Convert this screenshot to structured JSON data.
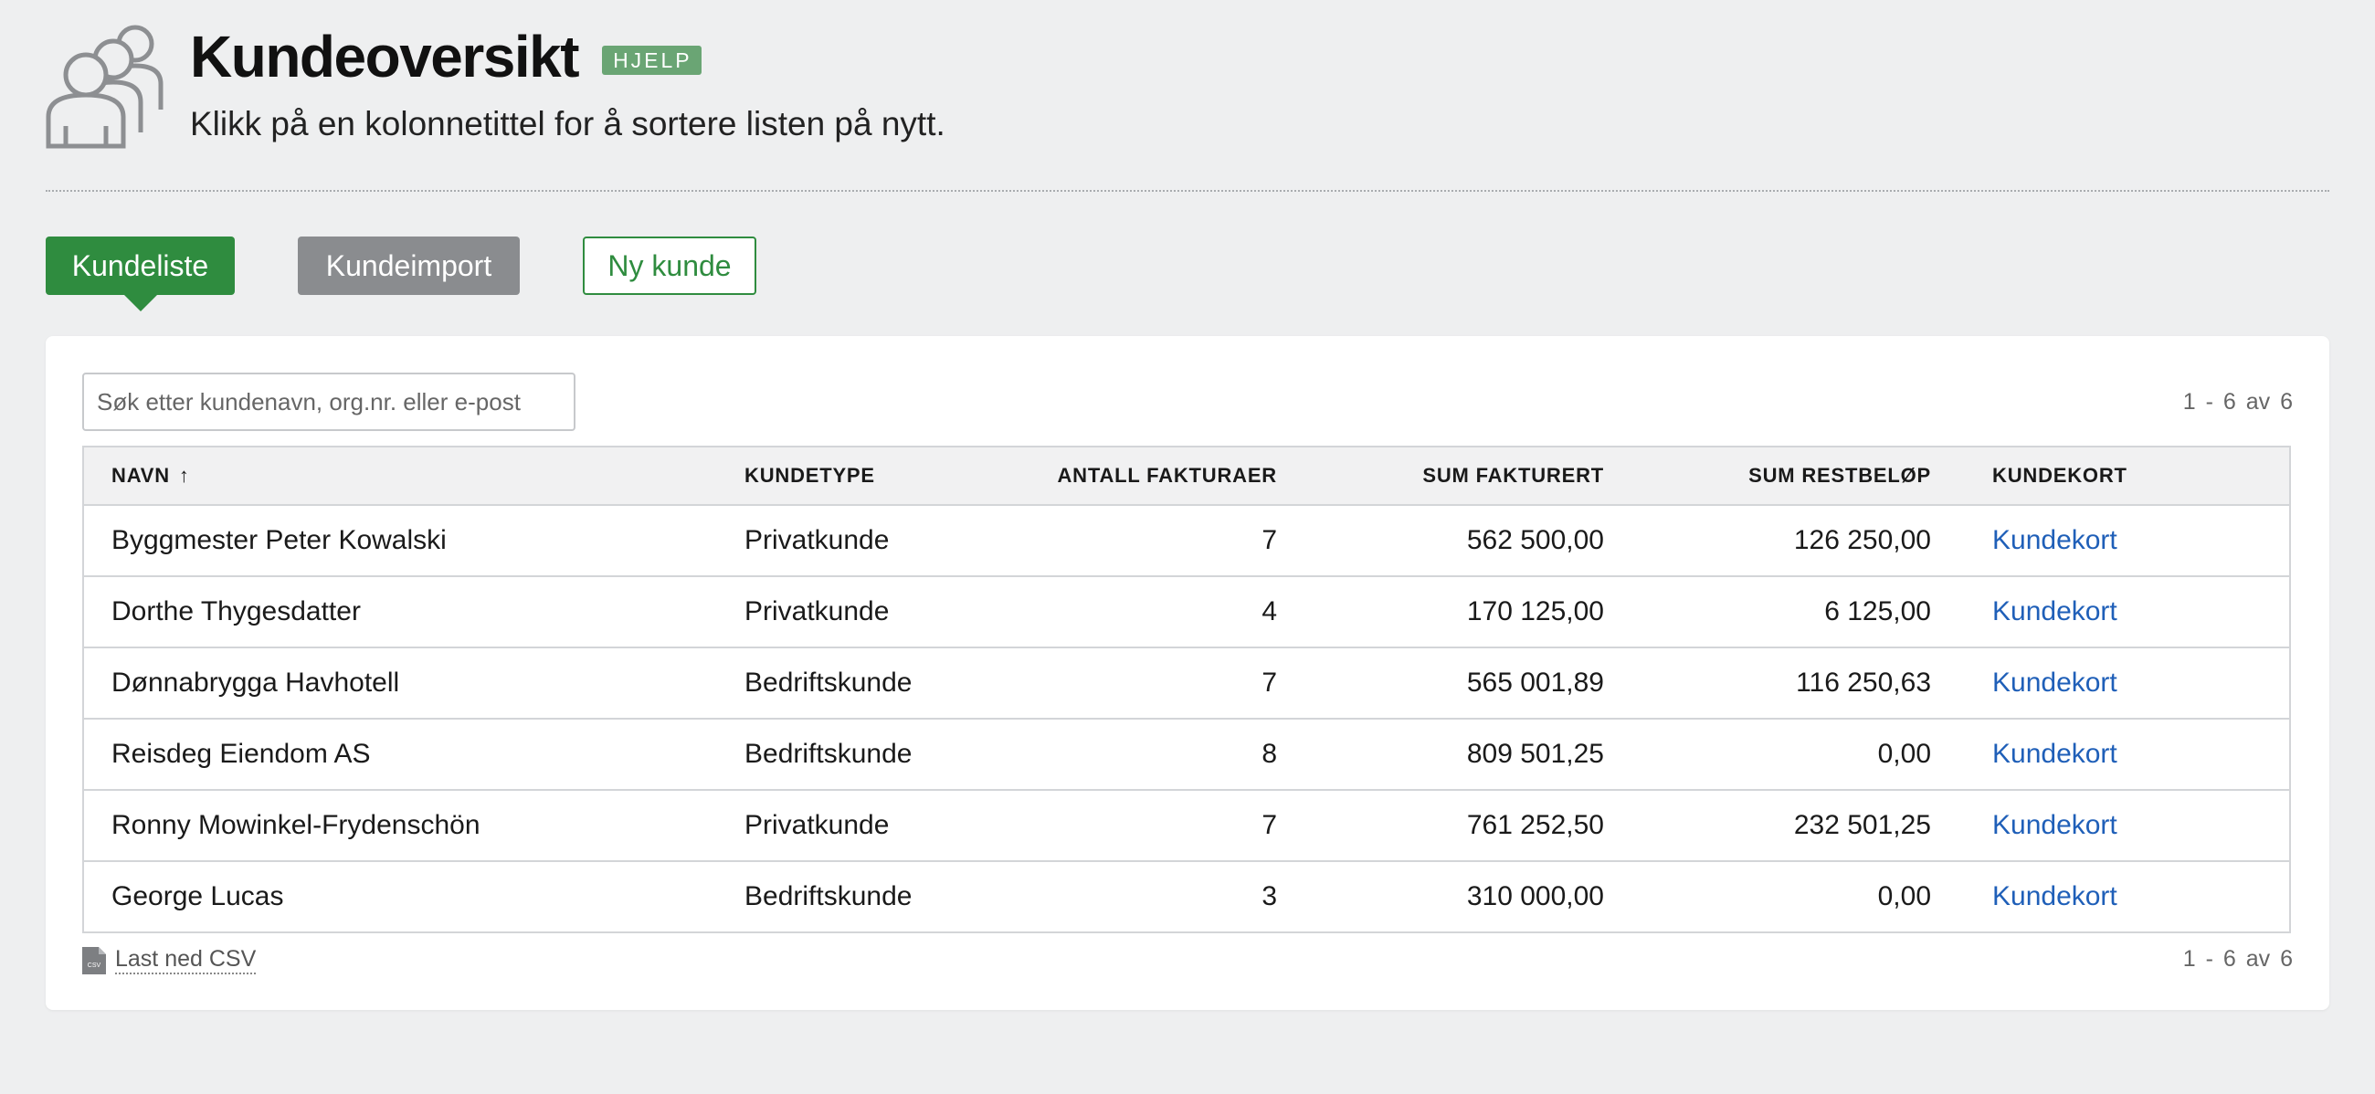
{
  "header": {
    "title": "Kundeoversikt",
    "help_badge": "HJELP",
    "subtitle": "Klikk på en kolonnetittel for å sortere listen på nytt."
  },
  "tabs": [
    {
      "label": "Kundeliste",
      "active": true
    },
    {
      "label": "Kundeimport",
      "active": false
    },
    {
      "label": "Ny kunde",
      "active": false
    }
  ],
  "search": {
    "placeholder": "Søk etter kundenavn, org.nr. eller e-post",
    "value": ""
  },
  "pagination": {
    "top": "1 - 6 av 6",
    "bottom": "1 - 6 av 6"
  },
  "table": {
    "columns": {
      "name": "NAVN",
      "type": "KUNDETYPE",
      "invoice_count": "ANTALL FAKTURAER",
      "sum_invoiced": "SUM FAKTURERT",
      "sum_remaining": "SUM RESTBELØP",
      "card": "KUNDEKORT"
    },
    "sort": {
      "column": "NAVN",
      "direction": "ascending",
      "icon": "arrow-up-icon"
    },
    "rows": [
      {
        "name": "Byggmester Peter Kowalski",
        "type": "Privatkunde",
        "invoice_count": "7",
        "sum_invoiced": "562 500,00",
        "sum_remaining": "126 250,00",
        "card": "Kundekort"
      },
      {
        "name": "Dorthe Thygesdatter",
        "type": "Privatkunde",
        "invoice_count": "4",
        "sum_invoiced": "170 125,00",
        "sum_remaining": "6 125,00",
        "card": "Kundekort"
      },
      {
        "name": "Dønnabrygga Havhotell",
        "type": "Bedriftskunde",
        "invoice_count": "7",
        "sum_invoiced": "565 001,89",
        "sum_remaining": "116 250,63",
        "card": "Kundekort"
      },
      {
        "name": "Reisdeg Eiendom AS",
        "type": "Bedriftskunde",
        "invoice_count": "8",
        "sum_invoiced": "809 501,25",
        "sum_remaining": "0,00",
        "card": "Kundekort"
      },
      {
        "name": "Ronny Mowinkel-Frydenschön",
        "type": "Privatkunde",
        "invoice_count": "7",
        "sum_invoiced": "761 252,50",
        "sum_remaining": "232 501,25",
        "card": "Kundekort"
      },
      {
        "name": "George Lucas",
        "type": "Bedriftskunde",
        "invoice_count": "3",
        "sum_invoiced": "310 000,00",
        "sum_remaining": "0,00",
        "card": "Kundekort"
      }
    ]
  },
  "footer": {
    "csv_icon": "csv-file-icon",
    "csv_icon_text": "CSV",
    "csv_link": "Last ned CSV"
  },
  "colors": {
    "accent": "#2f8c3f",
    "badge": "#6aa574",
    "link": "#1f5fb8",
    "muted_tab": "#8a8c8f",
    "background": "#eeeff0"
  }
}
